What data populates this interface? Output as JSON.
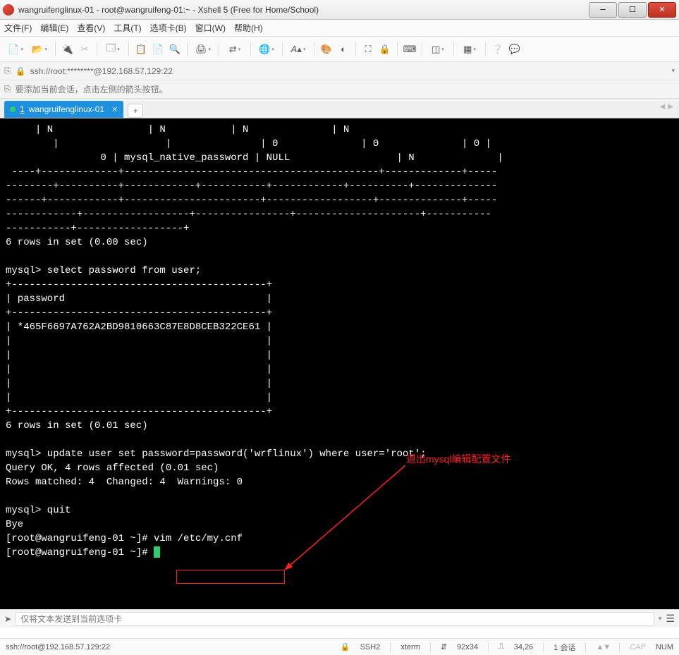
{
  "window": {
    "title": "wangruifenglinux-01 - root@wangruifeng-01:~ - Xshell 5 (Free for Home/School)"
  },
  "menubar": {
    "file": "文件(F)",
    "edit": "编辑(E)",
    "view": "查看(V)",
    "tools": "工具(T)",
    "tabs": "选项卡(B)",
    "window": "窗口(W)",
    "help": "帮助(H)"
  },
  "address": {
    "text": "ssh://root:********@192.168.57.129:22"
  },
  "hint": {
    "text": "要添加当前会话，点击左侧的箭头按钮。"
  },
  "tab": {
    "index": "1",
    "label": "wangruifenglinux-01"
  },
  "terminal_lines": [
    "     | N                | N           | N              | N",
    "        |                  |               | 0              | 0              | 0 |",
    "                0 | mysql_native_password | NULL                  | N              |",
    " ----+-------------+-------------------------------------------+-------------+-----",
    "--------+----------+------------+-----------+------------+----------+--------------",
    "------+------------+-----------------------+------------------+--------------+-----",
    "------------+------------------+----------------+---------------------+-----------",
    "-----------+------------------+",
    "6 rows in set (0.00 sec)",
    "",
    "mysql> select password from user;",
    "+-------------------------------------------+",
    "| password                                  |",
    "+-------------------------------------------+",
    "| *465F6697A762A2BD9810663C87E8D8CEB322CE61 |",
    "|                                           |",
    "|                                           |",
    "|                                           |",
    "|                                           |",
    "|                                           |",
    "+-------------------------------------------+",
    "6 rows in set (0.01 sec)",
    "",
    "mysql> update user set password=password('wrflinux') where user='root';",
    "Query OK, 4 rows affected (0.01 sec)",
    "Rows matched: 4  Changed: 4  Warnings: 0",
    "",
    "mysql> quit",
    "Bye",
    "[root@wangruifeng-01 ~]# vim /etc/my.cnf",
    "[root@wangruifeng-01 ~]# "
  ],
  "annotation": {
    "text": "退出mysql编辑配置文件"
  },
  "inputbar": {
    "placeholder": "仅将文本发送到当前选项卡"
  },
  "status": {
    "conn": "ssh://root@192.168.57.129:22",
    "proto": "SSH2",
    "term": "xterm",
    "size": "92x34",
    "pos": "34,26",
    "sessions": "1 会话",
    "cap": "CAP",
    "num": "NUM"
  },
  "icons": {
    "lock": "🔒",
    "size_prefix": "⇵"
  }
}
